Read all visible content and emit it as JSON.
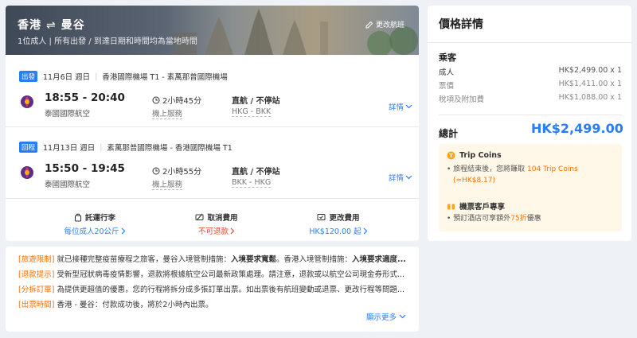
{
  "header": {
    "origin": "香港",
    "destination": "曼谷",
    "route_arrow": "⇌",
    "subtitle": "1位成人  |  所有出發 / 到達日期和時間均為當地時間",
    "change_flight": "更改航班"
  },
  "segments": [
    {
      "badge": "出發",
      "date": "11月6日 週日",
      "route": "香港國際機場 T1 - 素萬那普國際機場",
      "times": "18:55 - 20:40",
      "airline": "泰國國際航空",
      "duration": "2小時45分",
      "service": "機上服務",
      "stop": "直航 / 不停站",
      "codes": "HKG - BKK",
      "detail": "詳情"
    },
    {
      "badge": "回程",
      "date": "11月13日 週日",
      "route": "素萬那普國際機場 - 香港國際機場 T1",
      "times": "15:50 - 19:45",
      "airline": "泰國國際航空",
      "duration": "2小時55分",
      "service": "機上服務",
      "stop": "直航 / 不停站",
      "codes": "BKK - HKG",
      "detail": "詳情"
    }
  ],
  "fees": [
    {
      "title": "託運行李",
      "value": "每位成人20公斤",
      "color": "#287dfa",
      "icon": "luggage-icon"
    },
    {
      "title": "取消費用",
      "value": "不可退款",
      "color": "#e9462a",
      "icon": "cancel-fee-icon"
    },
    {
      "title": "更改費用",
      "value": "HK$120.00 起",
      "color": "#287dfa",
      "icon": "change-fee-icon"
    }
  ],
  "notes": [
    {
      "tag": "[旅遊限制]",
      "text": " 就已接種完整疫苗療程之旅客，曼谷入境管制措施：",
      "bold": "入境要求寬鬆",
      "text2": "。香港入境管制措施：",
      "bold2": "入境要求適度..."
    },
    {
      "tag": "[退款提示]",
      "text": " 受新型冠狀病毒疫情影響，退款將根據航空公司最新政策處理。請注意，退款或以航空公司現金券形式...",
      "bold": "",
      "text2": "",
      "bold2": ""
    },
    {
      "tag": "[分拆訂單]",
      "text": " 為提供更超值的優惠，您的行程將拆分成多張訂單出票。如出票後有航班變動或退票、更改行程等問題...",
      "bold": "",
      "text2": "",
      "bold2": ""
    },
    {
      "tag": "[出票時間]",
      "text": " 香港 - 曼谷：付款成功後，將於2小時內出票。",
      "bold": "",
      "text2": "",
      "bold2": ""
    }
  ],
  "show_more": "顯示更多",
  "price": {
    "title": "價格詳情",
    "passengers_title": "乘客",
    "rows": [
      {
        "label": "成人",
        "value": "HK$2,499.00 x 1",
        "sub": false
      },
      {
        "label": "票價",
        "value": "HK$1,411.00 x 1",
        "sub": true
      },
      {
        "label": "稅項及附加費",
        "value": "HK$1,088.00 x 1",
        "sub": true
      }
    ],
    "total_label": "總計",
    "total_value": "HK$2,499.00"
  },
  "promo": {
    "coins_title": "Trip Coins",
    "coins_pre": "旅程結束後，您將賺取 ",
    "coins_amount": "104 Trip Coins",
    "coins_value": "(≈HK$8.17)",
    "member_title": "機票客戶專享",
    "member_pre": "預訂酒店可享額外",
    "member_pct": "75折",
    "member_post": "優惠"
  },
  "colors": {
    "accent": "#287dfa",
    "warning": "#ff6f00",
    "danger": "#e9462a"
  }
}
